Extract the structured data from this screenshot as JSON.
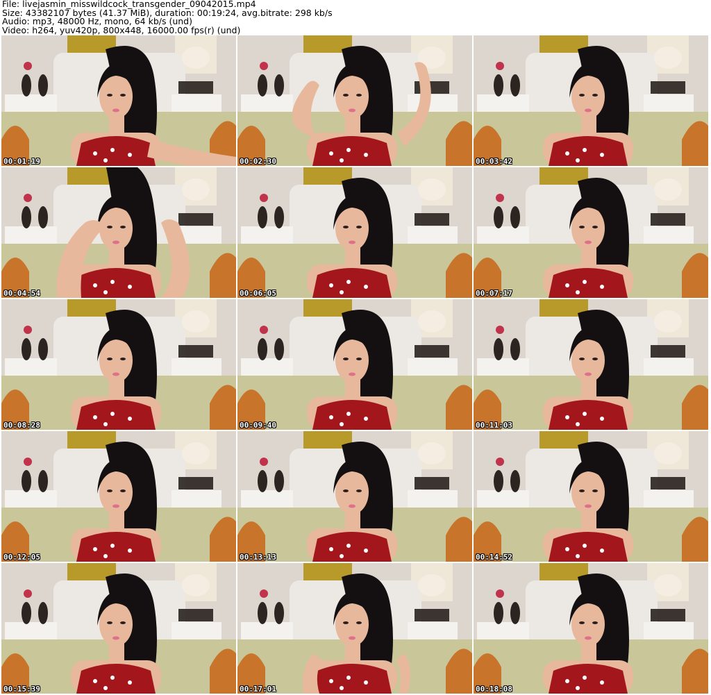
{
  "header": {
    "file": "File: livejasmin_misswildcock_transgender_09042015.mp4",
    "size": "Size: 43382107 bytes (41.37 MiB), duration: 00:19:24, avg.bitrate: 298 kb/s",
    "audio": "Audio: mp3, 48000 Hz, mono, 64 kb/s (und)",
    "video": "Video: h264, yuv420p, 800x448, 16000.00 fps(r) (und)"
  },
  "colors": {
    "wall": "#dcd6cf",
    "curtain": "#b89a2a",
    "headboard": "#ece9e4",
    "bedding": "#c9c79a",
    "floor": "#c8742a",
    "hair": "#141012",
    "skin": "#e7b89c",
    "dress": "#a3161c"
  },
  "thumbnails": [
    {
      "timestamp": "00:01:19",
      "pose": "arm-out"
    },
    {
      "timestamp": "00:02:30",
      "pose": "hands-up"
    },
    {
      "timestamp": "00:03:42",
      "pose": "neutral"
    },
    {
      "timestamp": "00:04:54",
      "pose": "hand-head"
    },
    {
      "timestamp": "00:06:05",
      "pose": "neutral"
    },
    {
      "timestamp": "00:07:17",
      "pose": "neutral"
    },
    {
      "timestamp": "00:08:28",
      "pose": "neutral"
    },
    {
      "timestamp": "00:09:40",
      "pose": "neutral"
    },
    {
      "timestamp": "00:11:03",
      "pose": "neutral"
    },
    {
      "timestamp": "00:12:05",
      "pose": "neutral"
    },
    {
      "timestamp": "00:13:13",
      "pose": "neutral"
    },
    {
      "timestamp": "00:14:52",
      "pose": "neutral"
    },
    {
      "timestamp": "00:15:39",
      "pose": "neutral"
    },
    {
      "timestamp": "00:17:01",
      "pose": "hands-hips"
    },
    {
      "timestamp": "00:18:08",
      "pose": "neutral"
    }
  ]
}
